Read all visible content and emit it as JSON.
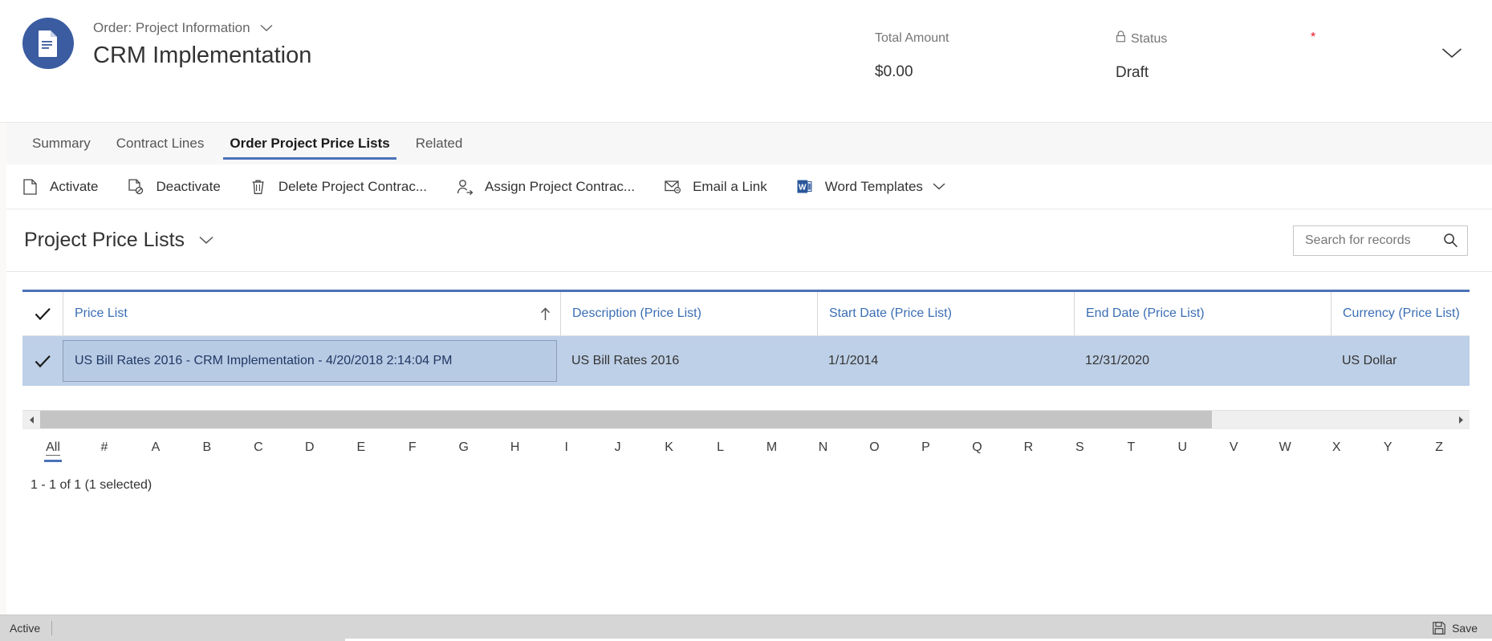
{
  "header": {
    "entity_icon": "document-icon",
    "form_selector_label": "Order: Project Information",
    "form_selector_chevron": "chevron-down-icon",
    "record_name": "CRM Implementation",
    "fields": [
      {
        "label": "Total Amount",
        "value": "$0.00",
        "icon": ""
      },
      {
        "label": "Status",
        "value": "Draft",
        "icon": "lock-icon"
      }
    ],
    "required_marker": "*",
    "collapse_icon": "chevron-down-icon"
  },
  "tabs": [
    {
      "label": "Summary",
      "active": false
    },
    {
      "label": "Contract Lines",
      "active": false
    },
    {
      "label": "Order Project Price Lists",
      "active": true
    },
    {
      "label": "Related",
      "active": false
    }
  ],
  "command_bar": [
    {
      "label": "Activate",
      "icon": "page-icon",
      "chevron": false
    },
    {
      "label": "Deactivate",
      "icon": "page-block-icon",
      "chevron": false
    },
    {
      "label": "Delete Project Contrac...",
      "icon": "trash-icon",
      "chevron": false
    },
    {
      "label": "Assign Project Contrac...",
      "icon": "assign-user-icon",
      "chevron": false
    },
    {
      "label": "Email a Link",
      "icon": "email-link-icon",
      "chevron": false
    },
    {
      "label": "Word Templates",
      "icon": "word-icon",
      "chevron": true
    }
  ],
  "subgrid": {
    "title": "Project Price Lists",
    "title_chevron": "chevron-down-icon",
    "search": {
      "placeholder": "Search for records",
      "value": "",
      "icon": "search-icon"
    },
    "select_all_icon": "checkmark-icon",
    "columns": [
      {
        "label": "Price List",
        "sorted": true,
        "sort_icon": "sort-ascending-icon"
      },
      {
        "label": "Description (Price List)",
        "sorted": false,
        "sort_icon": ""
      },
      {
        "label": "Start Date (Price List)",
        "sorted": false,
        "sort_icon": ""
      },
      {
        "label": "End Date (Price List)",
        "sorted": false,
        "sort_icon": ""
      },
      {
        "label": "Currency (Price List)",
        "sorted": false,
        "sort_icon": ""
      }
    ],
    "rows": [
      {
        "selected": true,
        "row_check_icon": "checkmark-icon",
        "price_list": "US Bill Rates 2016 - CRM Implementation - 4/20/2018 2:14:04 PM",
        "description": "US Bill Rates 2016",
        "start_date": "1/1/2014",
        "end_date": "12/31/2020",
        "currency": "US Dollar"
      }
    ],
    "scroll_left_icon": "caret-left-icon",
    "scroll_right_icon": "caret-right-icon",
    "alphabet": [
      "All",
      "#",
      "A",
      "B",
      "C",
      "D",
      "E",
      "F",
      "G",
      "H",
      "I",
      "J",
      "K",
      "L",
      "M",
      "N",
      "O",
      "P",
      "Q",
      "R",
      "S",
      "T",
      "U",
      "V",
      "W",
      "X",
      "Y",
      "Z"
    ],
    "alphabet_selected": "All",
    "record_count": "1 - 1 of 1 (1 selected)"
  },
  "status_bar": {
    "state": "Active",
    "save_label": "Save",
    "save_icon": "save-icon"
  },
  "colors": {
    "accent": "#4a72b8",
    "avatar": "#3b5ca0",
    "link": "#3b6eb4",
    "selected_row": "#bed0e7",
    "required": "#e81123",
    "tab_strip_bg": "#f7f7f7",
    "status_bar_bg": "#d6d6d6"
  }
}
